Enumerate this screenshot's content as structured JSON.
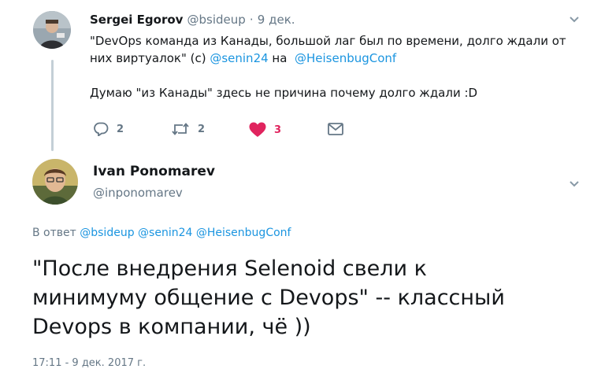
{
  "parent_tweet": {
    "author_name": "Sergei Egorov",
    "author_handle": "@bsideup",
    "separator": "·",
    "date": "9 дек.",
    "line1": "\"DevOps команда из Канады, большой лаг был по времени, долго ждали от",
    "line2_pre": "них виртуалок\" (c) ",
    "mention1": "@senin24",
    "line2_mid": " на  ",
    "mention2": "@HeisenbugConf",
    "line3": "Думаю \"из Канады\" здесь не причина почему долго ждали :D",
    "actions": {
      "reply_count": "2",
      "retweet_count": "2",
      "like_count": "3"
    }
  },
  "main_tweet": {
    "author_name": "Ivan Ponomarev",
    "author_handle": "@inponomarev",
    "reply_label": "В ответ",
    "reply_mentions": [
      "@bsideup",
      "@senin24",
      "@HeisenbugConf"
    ],
    "text_lines": [
      "\"После внедрения Selenoid свели к",
      "минимуму общение с Devops\" -- классный",
      "Devops в компании, чё ))"
    ],
    "footer_partial": "17:11 - 9 дек. 2017 г."
  },
  "colors": {
    "link": "#1b95e0",
    "like": "#e0245e",
    "muted": "#657786",
    "text": "#14171a"
  },
  "icons": {
    "reply": "speech-bubble-icon",
    "retweet": "retweet-arrows-icon",
    "like": "heart-icon",
    "dm": "envelope-icon",
    "menu": "chevron-down-icon"
  }
}
